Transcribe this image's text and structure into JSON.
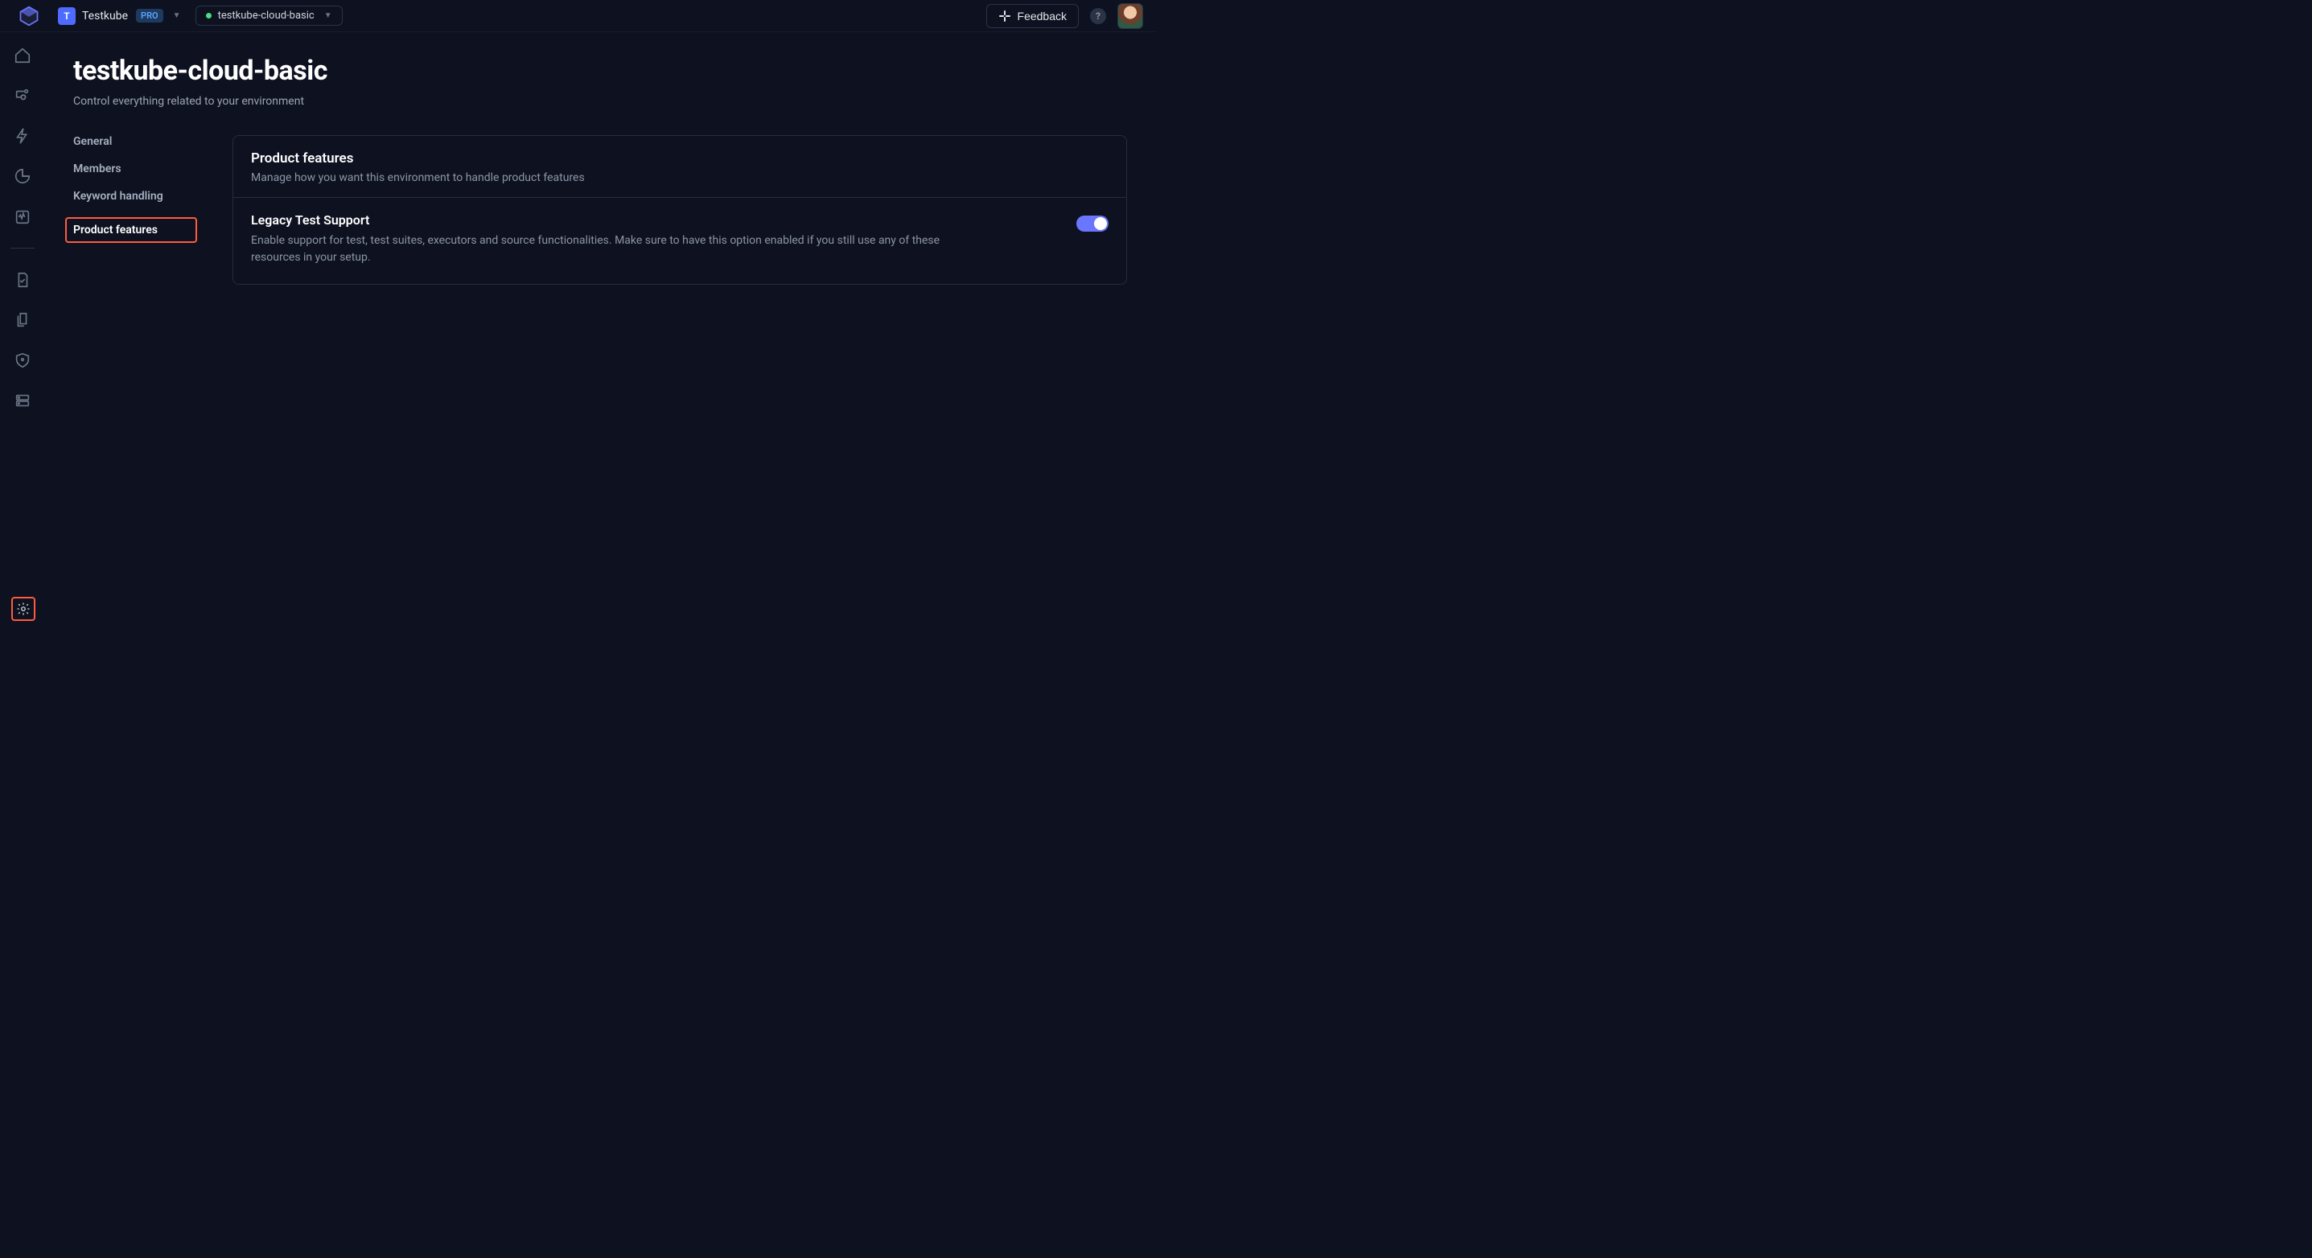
{
  "topbar": {
    "org_avatar_letter": "T",
    "org_name": "Testkube",
    "plan_badge": "PRO",
    "env_name": "testkube-cloud-basic",
    "feedback_label": "Feedback"
  },
  "page": {
    "title": "testkube-cloud-basic",
    "subtitle": "Control everything related to your environment"
  },
  "settings_nav": {
    "items": [
      {
        "label": "General",
        "active": false
      },
      {
        "label": "Members",
        "active": false
      },
      {
        "label": "Keyword handling",
        "active": false
      },
      {
        "label": "Product features",
        "active": true
      }
    ]
  },
  "panel": {
    "title": "Product features",
    "description": "Manage how you want this environment to handle product features",
    "feature": {
      "title": "Legacy Test Support",
      "description": "Enable support for test, test suites, executors and source functionalities. Make sure to have this option enabled if you still use any of these resources in your setup.",
      "enabled": true
    }
  },
  "colors": {
    "highlight_border": "#ff5b3e",
    "accent": "#6b76ff"
  }
}
